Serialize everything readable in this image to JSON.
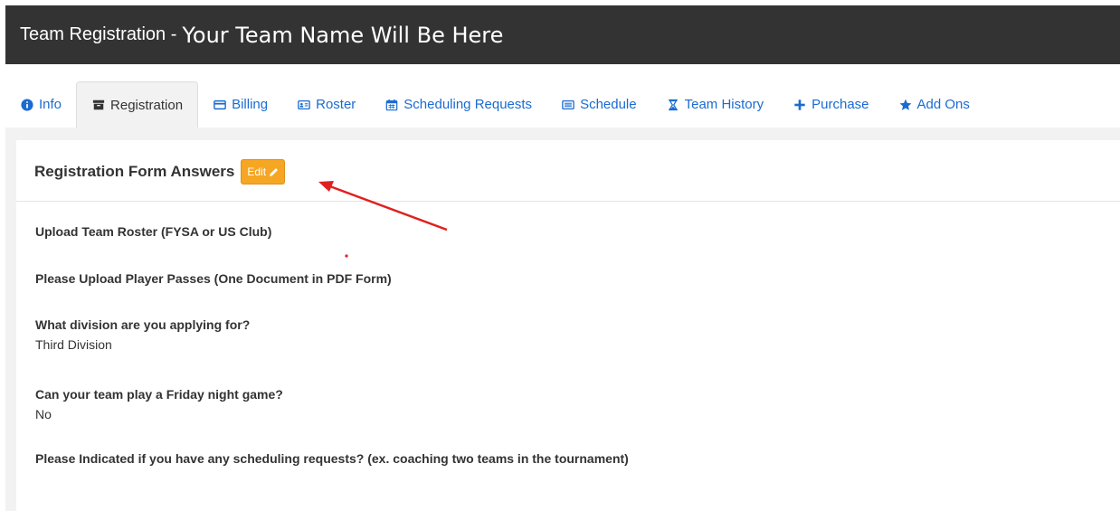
{
  "header": {
    "prefix": "Team Registration - ",
    "team_name": "Your Team Name Will Be Here"
  },
  "tabs": [
    {
      "label": "Info",
      "icon": "info-circle-icon",
      "active": false
    },
    {
      "label": "Registration",
      "icon": "archive-icon",
      "active": true
    },
    {
      "label": "Billing",
      "icon": "credit-card-icon",
      "active": false
    },
    {
      "label": "Roster",
      "icon": "id-card-icon",
      "active": false
    },
    {
      "label": "Scheduling Requests",
      "icon": "calendar-icon",
      "active": false
    },
    {
      "label": "Schedule",
      "icon": "list-icon",
      "active": false
    },
    {
      "label": "Team History",
      "icon": "hourglass-icon",
      "active": false
    },
    {
      "label": "Purchase",
      "icon": "plus-icon",
      "active": false
    },
    {
      "label": "Add Ons",
      "icon": "star-icon",
      "active": false
    }
  ],
  "panel": {
    "title": "Registration Form Answers",
    "edit_label": "Edit",
    "edit_icon": "pencil-icon",
    "questions": [
      {
        "q": "Upload Team Roster (FYSA or US Club)",
        "a": ""
      },
      {
        "q": "Please Upload Player Passes (One Document in PDF Form)",
        "a": ""
      },
      {
        "q": "What division are you applying for?",
        "a": "Third Division"
      },
      {
        "q": "Can your team play a Friday night game?",
        "a": "No"
      },
      {
        "q": "Please Indicated if you have any scheduling requests? (ex. coaching two teams in the tournament)",
        "a": ""
      }
    ]
  },
  "colors": {
    "header_bg": "#333333",
    "tab_link": "#1a6bd1",
    "edit_button": "#f5a623",
    "annotation_arrow": "#e02020"
  }
}
